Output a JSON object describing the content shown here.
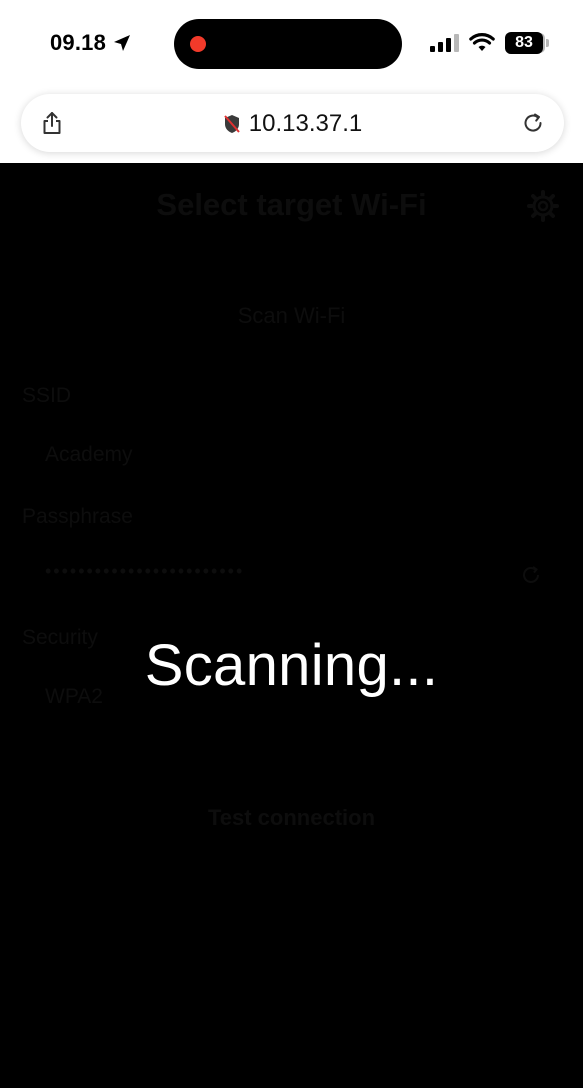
{
  "status_bar": {
    "time": "09.18",
    "battery": "83"
  },
  "browser": {
    "url": "10.13.37.1"
  },
  "page": {
    "title": "Select target Wi-Fi",
    "scan_button": "Scan Wi-Fi",
    "ssid_label": "SSID",
    "ssid_value": "Academy",
    "passphrase_label": "Passphrase",
    "passphrase_value": "••••••••••••••••••••••••",
    "security_label": "Security",
    "security_value": "WPA2",
    "test_button": "Test connection"
  },
  "overlay": {
    "message": "Scanning..."
  },
  "icons": {
    "location": "location-arrow-icon",
    "signal": "cellular-signal-icon",
    "wifi": "wifi-icon",
    "share": "share-icon",
    "privacy": "privacy-shield-icon",
    "reload": "reload-icon",
    "settings": "gear-icon",
    "toggle_visibility": "refresh-icon"
  }
}
